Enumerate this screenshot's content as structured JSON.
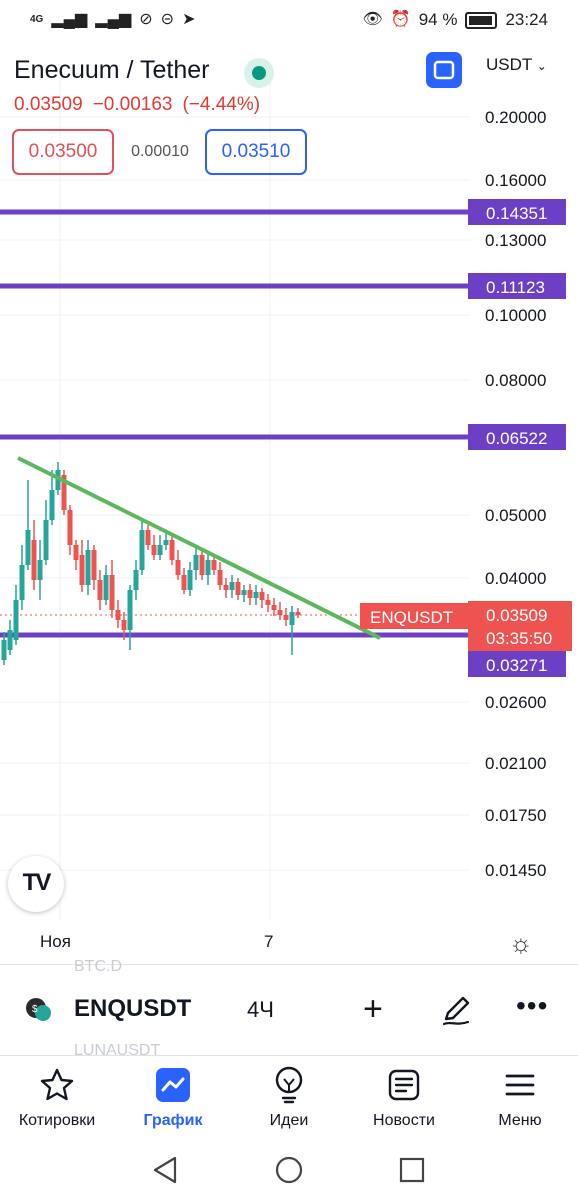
{
  "status": {
    "network": "4G",
    "battery": "94 %",
    "time": "23:24"
  },
  "header": {
    "title": "Enecuum / Tether",
    "currency": "USDT",
    "price": "0.03509",
    "change": "−0.00163",
    "change_pct": "(−4.44%)",
    "bid": "0.03500",
    "spread": "0.00010",
    "ask": "0.03510",
    "status_color": "#089981"
  },
  "chart": {
    "y_ticks": [
      "0.20000",
      "0.16000",
      "0.13000",
      "0.10000",
      "0.08000",
      "0.05000",
      "0.04000",
      "0.02600",
      "0.02100",
      "0.01750",
      "0.01450"
    ],
    "levels": [
      "0.14351",
      "0.11123",
      "0.06522",
      "0.03271"
    ],
    "level_color": "#6c3fc4",
    "trendline_color": "#5cb85c",
    "symbol_label": "ENQUSDT",
    "last_price": "0.03509",
    "countdown": "03:35:50",
    "x_labels": [
      "Ноя",
      "7"
    ],
    "up_color": "#26a69a",
    "down_color": "#ef5350"
  },
  "symbol_bar": {
    "ghost_top": "BTC.D",
    "symbol": "ENQUSDT",
    "interval": "4Ч",
    "ghost_bottom": "LUNAUSDT"
  },
  "nav": [
    {
      "label": "Котировки",
      "icon": "star-icon"
    },
    {
      "label": "График",
      "icon": "chart-icon"
    },
    {
      "label": "Идеи",
      "icon": "lightbulb-icon"
    },
    {
      "label": "Новости",
      "icon": "news-icon"
    },
    {
      "label": "Меню",
      "icon": "menu-icon"
    }
  ]
}
